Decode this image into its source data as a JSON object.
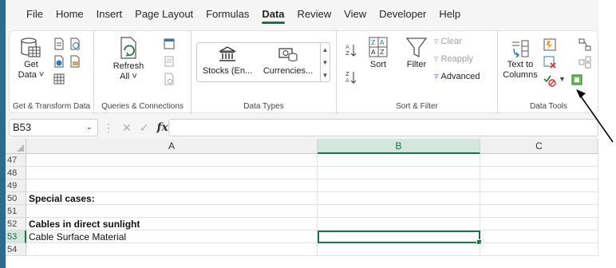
{
  "menu": {
    "tabs": [
      "File",
      "Home",
      "Insert",
      "Page Layout",
      "Formulas",
      "Data",
      "Review",
      "View",
      "Developer",
      "Help"
    ],
    "active_tab": "Data"
  },
  "ribbon": {
    "get_transform": {
      "get_data_line1": "Get",
      "get_data_line2": "Data ˅",
      "label": "Get & Transform Data"
    },
    "queries": {
      "refresh_line1": "Refresh",
      "refresh_line2": "All ˅",
      "label": "Queries & Connections"
    },
    "data_types": {
      "stocks": "Stocks (En...",
      "currencies": "Currencies...",
      "label": "Data Types"
    },
    "sort_filter": {
      "sort": "Sort",
      "filter": "Filter",
      "clear": "Clear",
      "reapply": "Reapply",
      "advanced": "Advanced",
      "label": "Sort & Filter"
    },
    "data_tools": {
      "text_to_columns_line1": "Text to",
      "text_to_columns_line2": "Columns",
      "label": "Data Tools"
    }
  },
  "formula_bar": {
    "name_box": "B53",
    "fx": "fx",
    "formula": ""
  },
  "grid": {
    "columns": [
      "A",
      "B",
      "C"
    ],
    "selected_column": "B",
    "rows": [
      {
        "num": "47",
        "a": "",
        "bold": false
      },
      {
        "num": "48",
        "a": "",
        "bold": false
      },
      {
        "num": "49",
        "a": "",
        "bold": false
      },
      {
        "num": "50",
        "a": "Special cases:",
        "bold": true
      },
      {
        "num": "51",
        "a": "",
        "bold": false
      },
      {
        "num": "52",
        "a": "Cables in direct sunlight",
        "bold": true
      },
      {
        "num": "53",
        "a": "Cable Surface Material",
        "bold": false
      },
      {
        "num": "54",
        "a": "",
        "bold": false
      }
    ],
    "active_row": "53"
  },
  "colors": {
    "accent": "#217346",
    "left_bar": "#2e6c8f"
  }
}
